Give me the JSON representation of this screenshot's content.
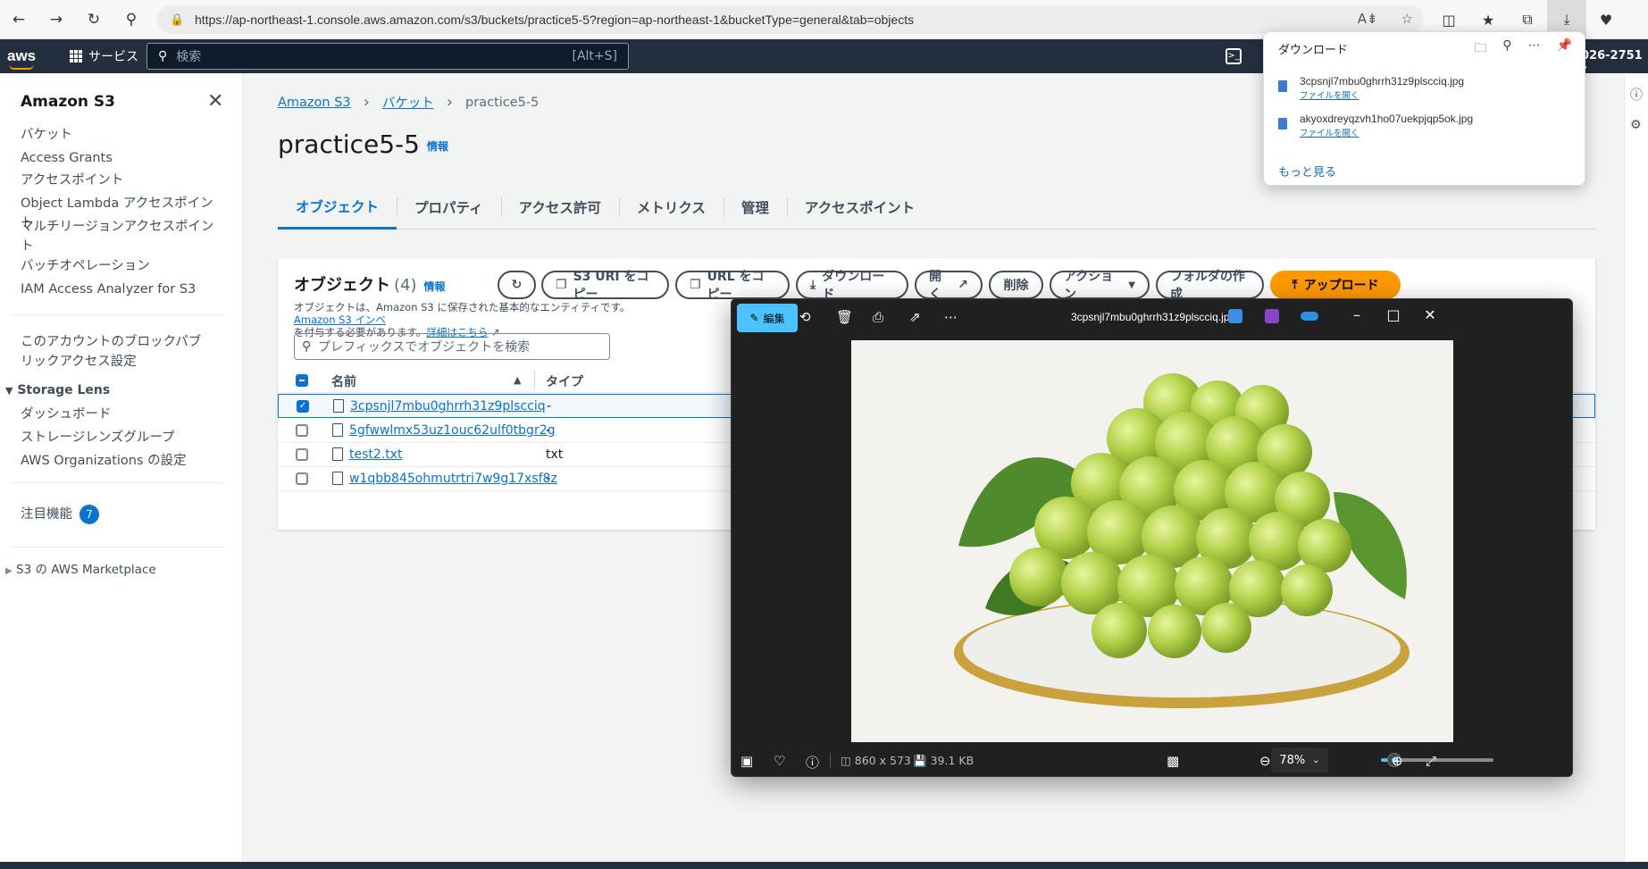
{
  "browser": {
    "url": "https://ap-northeast-1.console.aws.amazon.com/s3/buckets/practice5-5?region=ap-northeast-1&bucketType=general&tab=objects"
  },
  "aws_nav": {
    "logo": "aws",
    "services_label": "サービス",
    "search_placeholder": "検索",
    "search_shortcut": "[Alt+S]",
    "account": "026-2751 ▾"
  },
  "sidebar": {
    "title": "Amazon S3",
    "items": [
      "バケット",
      "Access Grants",
      "アクセスポイント",
      "Object Lambda アクセスポイント",
      "マルチリージョンアクセスポイント",
      "バッチオペレーション",
      "IAM Access Analyzer for S3",
      "このアカウントのブロックパブリックアクセス設定"
    ],
    "storage_lens": {
      "title": "Storage Lens",
      "items": [
        "ダッシュボード",
        "ストレージレンズグループ",
        "AWS Organizations の設定"
      ]
    },
    "featured": {
      "label": "注目機能",
      "count": "7"
    },
    "marketplace": "S3 の AWS Marketplace"
  },
  "breadcrumb": {
    "root": "Amazon S3",
    "buckets": "バケット",
    "current": "practice5-5"
  },
  "page": {
    "title": "practice5-5",
    "info": "情報"
  },
  "tabs": [
    "オブジェクト",
    "プロパティ",
    "アクセス許可",
    "メトリクス",
    "管理",
    "アクセスポイント"
  ],
  "objects_panel": {
    "title": "オブジェクト",
    "count": "(4)",
    "info": "情報",
    "desc_line1": "オブジェクトは、Amazon S3 に保存された基本的なエンティティです。",
    "desc_link1": "Amazon S3 インベ",
    "desc_line2": "を付与する必要があります。",
    "desc_link2": "詳細はこちら",
    "buttons": {
      "copy_s3_uri": "S3 URI をコピー",
      "copy_url": "URL をコピー",
      "download": "ダウンロード",
      "open": "開く",
      "delete": "削除",
      "actions": "アクション",
      "create_folder": "フォルダの作成",
      "upload": "アップロード"
    },
    "search_placeholder": "プレフィックスでオブジェクトを検索",
    "columns": {
      "name": "名前",
      "type": "タイプ"
    },
    "rows": [
      {
        "name": "3cpsnjl7mbu0ghrrh31z9plscciq",
        "type": "-"
      },
      {
        "name": "5gfwwlmx53uz1ouc62ulf0tbgr2g",
        "type": "-"
      },
      {
        "name": "test2.txt",
        "type": "txt"
      },
      {
        "name": "w1qbb845ohmutrtri7w9g17xsf8z",
        "type": "-"
      }
    ]
  },
  "viewer": {
    "edit_label": "編集",
    "title": "3cpsnjl7mbu0ghrrh31z9plscciq.jpg",
    "dimensions": "860 x 573",
    "filesize": "39.1 KB",
    "zoom": "78%",
    "zoom_fraction": 0.12
  },
  "downloads": {
    "title": "ダウンロード",
    "items": [
      {
        "name": "3cpsnjl7mbu0ghrrh31z9plscciq.jpg",
        "action": "ファイルを開く"
      },
      {
        "name": "akyoxdreyqzvh1ho07uekpjqp5ok.jpg",
        "action": "ファイルを開く"
      }
    ],
    "more": "もっと見る"
  },
  "colors": {
    "aws_nav": "#232f3e",
    "link": "#0972d3",
    "primary_button": "#ff9900",
    "viewer_bg": "#202020",
    "viewer_accent": "#4cc2ff"
  }
}
